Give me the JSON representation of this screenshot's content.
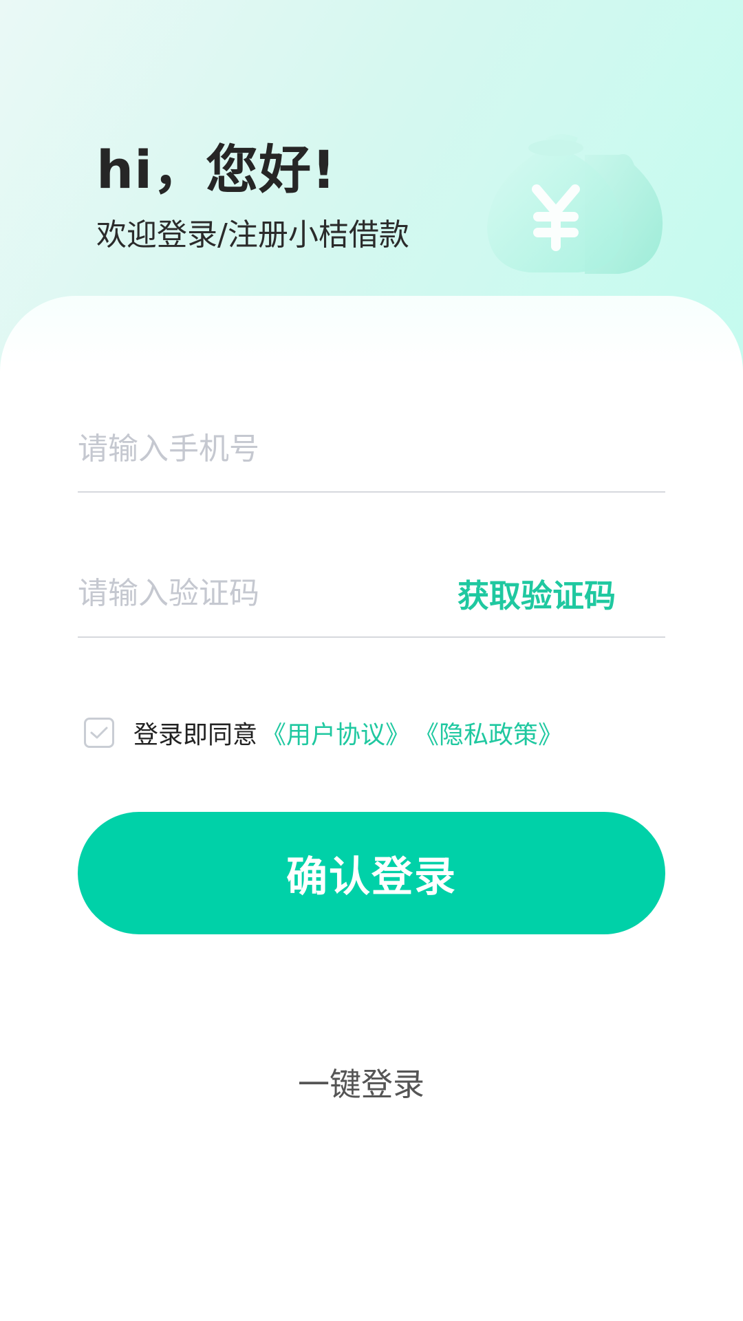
{
  "header": {
    "greeting": "hi，您好!",
    "subtitle": "欢迎登录/注册小桔借款"
  },
  "form": {
    "phone_placeholder": "请输入手机号",
    "code_placeholder": "请输入验证码",
    "get_code_label": "获取验证码"
  },
  "agreement": {
    "checked": true,
    "prefix": "登录即同意",
    "user_agreement": "《用户协议》",
    "privacy_policy": "《隐私政策》"
  },
  "actions": {
    "confirm_login": "确认登录",
    "one_click_login": "一键登录"
  },
  "icons": {
    "decor": "money-bag-icon",
    "check": "check-icon"
  },
  "colors": {
    "accent": "#00d1a8",
    "link": "#1fc8a0",
    "placeholder": "#c5c8d0",
    "hero_start": "#eaf9f6",
    "hero_end": "#c4fbef"
  }
}
